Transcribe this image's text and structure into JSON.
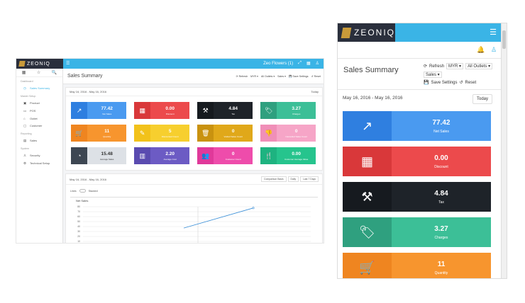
{
  "brand": "ZEONIQ",
  "desktop": {
    "topbar_user": "Zeo Flowers (1)",
    "sidebar": {
      "tabs": [
        "▦",
        "☆",
        "🔍"
      ],
      "sections": [
        {
          "title": "Dashboard",
          "items": [
            {
              "label": "Sales Summary",
              "icon": "◷",
              "active": true
            }
          ]
        },
        {
          "title": "Master Setup",
          "items": [
            {
              "label": "Product",
              "icon": "▣"
            },
            {
              "label": "POS",
              "icon": "▭"
            },
            {
              "label": "Outlet",
              "icon": "⌂"
            },
            {
              "label": "Customer",
              "icon": "▢"
            }
          ]
        },
        {
          "title": "Reporting",
          "items": [
            {
              "label": "Sales",
              "icon": "▤"
            }
          ]
        },
        {
          "title": "System",
          "items": [
            {
              "label": "Security",
              "icon": "♙"
            },
            {
              "label": "Technical Setup",
              "icon": "⚙"
            }
          ]
        }
      ]
    },
    "header": {
      "title": "Sales Summary",
      "controls": [
        "⟳ Refresh",
        "MYR ▾",
        "All Outlets ▾",
        "Sales ▾",
        "💾 Save Settings",
        "↺ Reset"
      ]
    },
    "panel1": {
      "date": "May 16, 2016 - May 16, 2016",
      "button": "Today"
    },
    "cards": [
      {
        "value": "77.42",
        "label": "Net Sales",
        "color": "#2f7fe0",
        "light": "#4a9af0",
        "icon": "↗"
      },
      {
        "value": "0.00",
        "label": "Discount",
        "color": "#d9383a",
        "light": "#ec4a4c",
        "icon": "▦"
      },
      {
        "value": "4.84",
        "label": "Tax",
        "color": "#161a1f",
        "light": "#1e2329",
        "icon": "⚒"
      },
      {
        "value": "3.27",
        "label": "Charges",
        "color": "#2fa07f",
        "light": "#3cbf97",
        "icon": "🏷"
      },
      {
        "value": "11",
        "label": "Quantity",
        "color": "#ef8520",
        "light": "#f7952e",
        "icon": "🛒"
      },
      {
        "value": "5",
        "label": "Discounted Count",
        "color": "#f2c21b",
        "light": "#f7cf2e",
        "icon": "✎"
      },
      {
        "value": "0",
        "label": "Voided Sales Count",
        "color": "#c9920f",
        "light": "#e0a81a",
        "icon": "🗑"
      },
      {
        "value": "0",
        "label": "Cancelled Sales Count",
        "color": "#f08fb8",
        "light": "#f6a5c7",
        "icon": "👎"
      },
      {
        "value": "15.48",
        "label": "Average Sales",
        "color": "#3d4652",
        "light": "#dde1e6",
        "icon": "◔",
        "dark": true
      },
      {
        "value": "2.20",
        "label": "Average Cost",
        "color": "#5a4bb0",
        "light": "#6c5bc4",
        "icon": "▥"
      },
      {
        "value": "0",
        "label": "Customer Count",
        "color": "#e0399a",
        "light": "#ee4cab",
        "icon": "👥"
      },
      {
        "value": "0.00",
        "label": "Customer Average Value",
        "color": "#1eb380",
        "light": "#26c48d",
        "icon": "🍴"
      }
    ],
    "panel2": {
      "date": "May 16, 2016 - May 16, 2016",
      "buttons": [
        "Comparison Basis",
        "Daily",
        "Last 7 Days"
      ],
      "toggle_left": "Lines",
      "toggle_right": "Stacked"
    },
    "chart_title": "Net Sales",
    "chart_data": {
      "type": "line",
      "title": "Net Sales",
      "xlabel": "",
      "ylabel": "",
      "ylim": [
        0,
        80
      ],
      "yticks": [
        0,
        10,
        20,
        30,
        40,
        50,
        60,
        70,
        80
      ],
      "series": [
        {
          "values": [
            37,
            77.42
          ]
        }
      ],
      "grid": true
    }
  },
  "mobile": {
    "header": {
      "title": "Sales Summary",
      "refresh": "Refresh",
      "currency": "MYR ▾",
      "outlets": "All Outlets ▾",
      "sales": "Sales ▾",
      "save": "Save Settings",
      "reset": "Reset"
    },
    "date": "May 16, 2016 - May 16, 2016",
    "today": "Today",
    "cards": [
      {
        "value": "77.42",
        "label": "Net Sales",
        "color": "#2f7fe0",
        "light": "#4a9af0",
        "icon": "↗"
      },
      {
        "value": "0.00",
        "label": "Discount",
        "color": "#d9383a",
        "light": "#ec4a4c",
        "icon": "▦"
      },
      {
        "value": "4.84",
        "label": "Tax",
        "color": "#161a1f",
        "light": "#1e2329",
        "icon": "⚒"
      },
      {
        "value": "3.27",
        "label": "Charges",
        "color": "#2fa07f",
        "light": "#3cbf97",
        "icon": "🏷"
      },
      {
        "value": "11",
        "label": "Quantity",
        "color": "#ef8520",
        "light": "#f7952e",
        "icon": "🛒"
      }
    ]
  }
}
